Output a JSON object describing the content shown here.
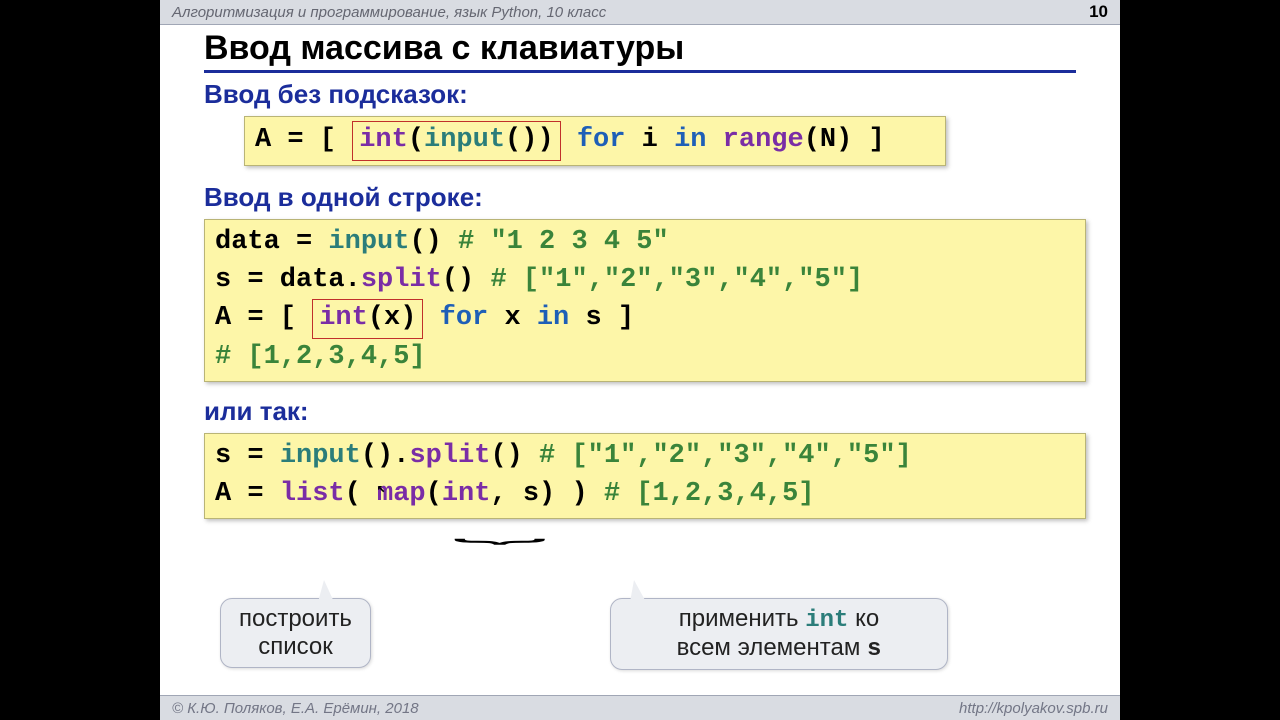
{
  "topbar": {
    "breadcrumb": "Алгоритмизация и программирование, язык Python, 10 класс",
    "page": "10"
  },
  "title": "Ввод массива с клавиатуры",
  "section1": {
    "label": "Ввод без подсказок:",
    "code": {
      "prefix": "A = [ ",
      "boxed_int": "int",
      "boxed_input": "input",
      "boxed_tail": "()",
      "boxed_close": ")",
      "for": " for",
      "mid": " i ",
      "in": "in",
      "range": " range",
      "suffix": "(N) ]"
    }
  },
  "section2": {
    "label": "Ввод в одной строке:",
    "code": {
      "l1a": "data = ",
      "l1_input": "input",
      "l1b": "()",
      "l1_comment": "   # \"1 2 3 4 5\"",
      "l2a": "s = data.",
      "l2_split": "split",
      "l2b": "()",
      "l2_comment": "  # [\"1\",\"2\",\"3\",\"4\",\"5\"]",
      "l3a": "A = [ ",
      "l3_boxed_int": "int",
      "l3_boxed_rest": "(x)",
      "l3_for": " for",
      "l3_mid": " x ",
      "l3_in": "in",
      "l3_tail": " s ]",
      "l4_comment": "                # [1,2,3,4,5]"
    }
  },
  "section3": {
    "label": "или так:",
    "code": {
      "l1a": "s = ",
      "l1_input": "input",
      "l1b": "().",
      "l1_split": "split",
      "l1c": "()",
      "l1_comment": "  # [\"1\",\"2\",\"3\",\"4\",\"5\"]",
      "l2a": "A = ",
      "l2_list": "list",
      "l2b": "( ",
      "l2_map": "map",
      "l2c": "(",
      "l2_int": "int",
      "l2d": ", s) )",
      "l2_comment": "  # [1,2,3,4,5]"
    }
  },
  "callouts": {
    "left": "построить\nсписок",
    "right_pre": "применить ",
    "right_mono": "int",
    "right_post": " ко\nвсем элементам ",
    "right_mono2": "s"
  },
  "footer": {
    "left": "© К.Ю. Поляков, Е.А. Ерёмин, 2018",
    "right": "http://kpolyakov.spb.ru"
  }
}
